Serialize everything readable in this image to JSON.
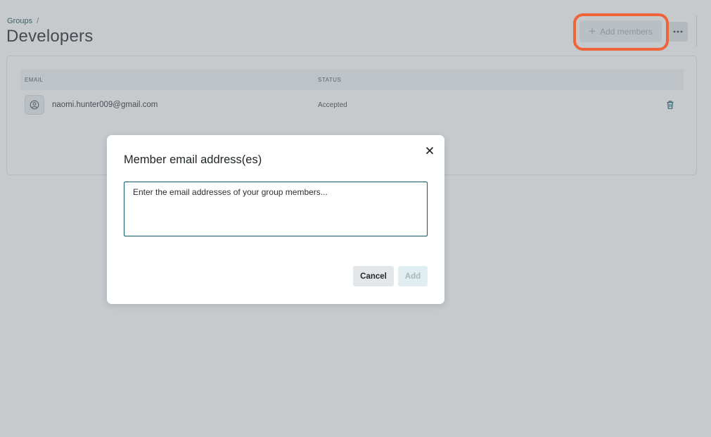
{
  "breadcrumb": {
    "parent": "Groups",
    "separator": "/"
  },
  "page": {
    "title": "Developers"
  },
  "header": {
    "add_members_label": "Add members",
    "more_icon": "ellipsis-icon"
  },
  "table": {
    "columns": {
      "email": "EMAIL",
      "status": "STATUS"
    },
    "rows": [
      {
        "email": "naomi.hunter009@gmail.com",
        "status": "Accepted"
      }
    ]
  },
  "modal": {
    "title": "Member email address(es)",
    "textarea": {
      "placeholder": "Enter the email addresses of your group members...",
      "value": ""
    },
    "cancel_label": "Cancel",
    "add_label": "Add"
  },
  "colors": {
    "accent": "#0b4f57",
    "highlight": "#f0643a",
    "overlay": "#768088"
  }
}
